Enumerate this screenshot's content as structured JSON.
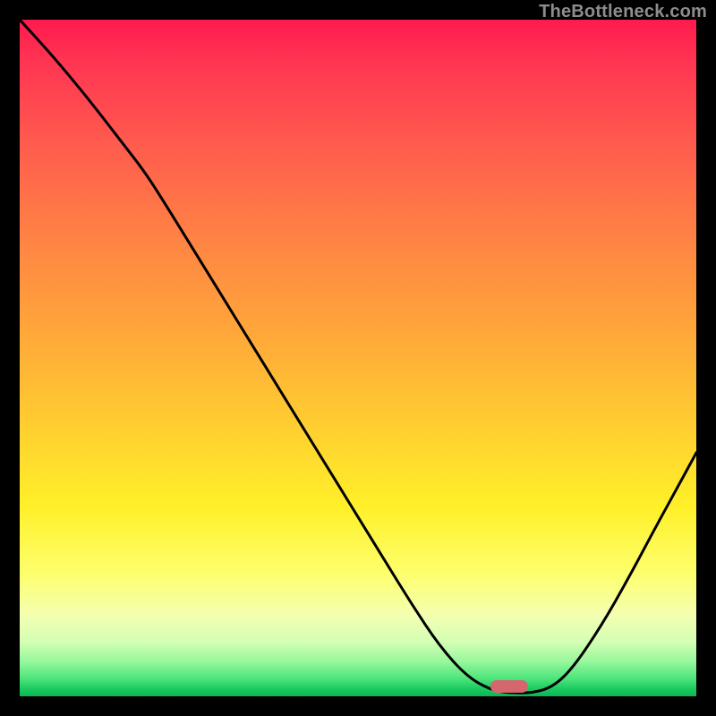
{
  "watermark": "TheBottleneck.com",
  "marker": {
    "x_frac": 0.723,
    "y_frac": 0.985
  },
  "chart_data": {
    "type": "line",
    "title": "",
    "xlabel": "",
    "ylabel": "",
    "xlim": [
      0,
      1
    ],
    "ylim": [
      0,
      1
    ],
    "grid": false,
    "legend": false,
    "series": [
      {
        "name": "curve",
        "x": [
          0.0,
          0.05,
          0.1,
          0.15,
          0.185,
          0.22,
          0.26,
          0.3,
          0.34,
          0.38,
          0.42,
          0.46,
          0.5,
          0.54,
          0.58,
          0.62,
          0.66,
          0.695,
          0.72,
          0.76,
          0.79,
          0.82,
          0.86,
          0.9,
          0.94,
          0.97,
          1.0
        ],
        "y": [
          1.0,
          0.945,
          0.885,
          0.82,
          0.775,
          0.72,
          0.655,
          0.59,
          0.525,
          0.46,
          0.395,
          0.33,
          0.265,
          0.2,
          0.135,
          0.075,
          0.03,
          0.01,
          0.005,
          0.005,
          0.015,
          0.045,
          0.105,
          0.175,
          0.25,
          0.305,
          0.36
        ]
      }
    ],
    "highlight": {
      "x_frac": 0.723,
      "y_frac": 0.015
    },
    "background_gradient": {
      "orientation": "vertical",
      "stops": [
        {
          "pos": 0.0,
          "color": "#ff1a4d"
        },
        {
          "pos": 0.5,
          "color": "#ffb835"
        },
        {
          "pos": 0.8,
          "color": "#fff84e"
        },
        {
          "pos": 0.95,
          "color": "#8ef598"
        },
        {
          "pos": 1.0,
          "color": "#0fb455"
        }
      ]
    }
  }
}
